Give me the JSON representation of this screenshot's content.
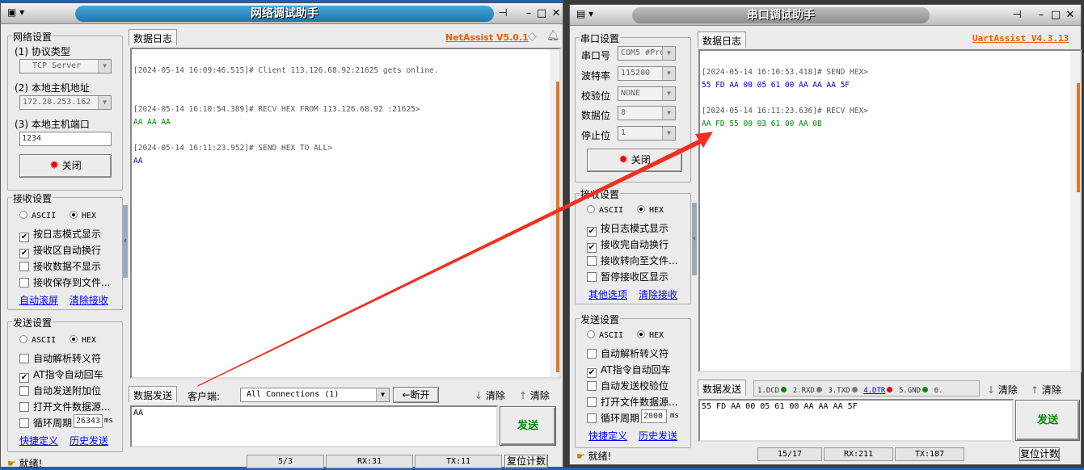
{
  "net": {
    "title": "网络调试助手",
    "brand": "NetAssist V5.0.1",
    "net_settings": {
      "title": "网络设置",
      "protocol_label": "(1) 协议类型",
      "protocol": "TCP Server",
      "host_label": "(2) 本地主机地址",
      "host": "172.28.253.162",
      "port_label": "(3) 本地主机端口",
      "port": "1234",
      "close_button": "关闭"
    },
    "recv_settings": {
      "title": "接收设置",
      "ascii": "ASCII",
      "hex": "HEX",
      "options": [
        {
          "label": "按日志模式显示",
          "checked": true
        },
        {
          "label": "接收区自动换行",
          "checked": true
        },
        {
          "label": "接收数据不显示",
          "checked": false
        },
        {
          "label": "接收保存到文件...",
          "checked": false
        }
      ],
      "link1": "自动滚屏",
      "link2": "清除接收"
    },
    "send_settings": {
      "title": "发送设置",
      "ascii": "ASCII",
      "hex": "HEX",
      "options": [
        {
          "label": "自动解析转义符",
          "checked": false
        },
        {
          "label": "AT指令自动回车",
          "checked": true
        },
        {
          "label": "自动发送附加位",
          "checked": false
        },
        {
          "label": "打开文件数据源...",
          "checked": false
        }
      ],
      "cycle_label": "循环周期",
      "cycle_value": "26343",
      "cycle_unit": "ms",
      "link1": "快捷定义",
      "link2": "历史发送"
    },
    "log_tab": "数据日志",
    "log": [
      {
        "ts": "[2024-05-14 16:09:46.515]# Client 113.126.68.92:21625 gets online.",
        "data": ""
      },
      {
        "ts": "[2024-05-14 16:10:54.389]# RECV HEX FROM 113.126.68.92 :21625>",
        "data": "AA AA AA",
        "kind": "recv"
      },
      {
        "ts": "[2024-05-14 16:11:23.952]# SEND HEX TO ALL>",
        "data": "AA",
        "kind": "send"
      }
    ],
    "send_tab": "数据发送",
    "client_label": "客户端:",
    "client_select": "All Connections (1)",
    "disconnect": "断开",
    "clear1": "清除",
    "clear2": "清除",
    "send_text": "AA",
    "send_button": "发送",
    "status": {
      "ready": "就绪!",
      "count": "5/3",
      "rx": "RX:31",
      "tx": "TX:11",
      "reset": "复位计数"
    }
  },
  "uart": {
    "title": "串口调试助手",
    "brand": "UartAssist V4.3.13",
    "port_settings": {
      "title": "串口设置",
      "port_label": "串口号",
      "port": "COM5 #Pro",
      "baud_label": "波特率",
      "baud": "115200",
      "parity_label": "校验位",
      "parity": "NONE",
      "databits_label": "数据位",
      "databits": "8",
      "stopbits_label": "停止位",
      "stopbits": "1",
      "close_button": "关闭"
    },
    "recv_settings": {
      "title": "接收设置",
      "ascii": "ASCII",
      "hex": "HEX",
      "options": [
        {
          "label": "按日志模式显示",
          "checked": true
        },
        {
          "label": "接收完自动换行",
          "checked": true
        },
        {
          "label": "接收转向至文件...",
          "checked": false
        },
        {
          "label": "暂停接收区显示",
          "checked": false
        }
      ],
      "link1": "其他选项",
      "link2": "清除接收"
    },
    "send_settings": {
      "title": "发送设置",
      "ascii": "ASCII",
      "hex": "HEX",
      "options": [
        {
          "label": "自动解析转义符",
          "checked": false
        },
        {
          "label": "AT指令自动回车",
          "checked": true
        },
        {
          "label": "自动发送校验位",
          "checked": false
        },
        {
          "label": "打开文件数据源...",
          "checked": false
        }
      ],
      "cycle_label": "循环周期",
      "cycle_value": "2000",
      "cycle_unit": "ms",
      "link1": "快捷定义",
      "link2": "历史发送"
    },
    "log_tab": "数据日志",
    "log": [
      {
        "ts": "[2024-05-14 16:10:53.418]# SEND HEX>",
        "data": "55 FD AA 00 05 61 00 AA AA AA 5F",
        "kind": "send"
      },
      {
        "ts": "[2024-05-14 16:11:23.636]# RECV HEX>",
        "data": "AA FD 55 00 03 61 00 AA 0B",
        "kind": "recv"
      }
    ],
    "send_tab": "数据发送",
    "pins": [
      {
        "label": "1.DCD",
        "color": "#0a8a0a"
      },
      {
        "label": "2.RXD",
        "color": "#777777"
      },
      {
        "label": "3.TXD",
        "color": "#777777"
      },
      {
        "label": "4.DTR",
        "color": "#ee0000"
      },
      {
        "label": "5.GND",
        "color": "#0a8a0a"
      },
      {
        "label": "6.",
        "color": ""
      }
    ],
    "clear1": "清除",
    "clear2": "清除",
    "send_text": "55 FD AA 00 05 61 00 AA AA AA 5F",
    "send_button": "发送",
    "status": {
      "ready": "就绪!",
      "count": "15/17",
      "rx": "RX:211",
      "tx": "TX:187",
      "reset": "复位计数"
    }
  }
}
